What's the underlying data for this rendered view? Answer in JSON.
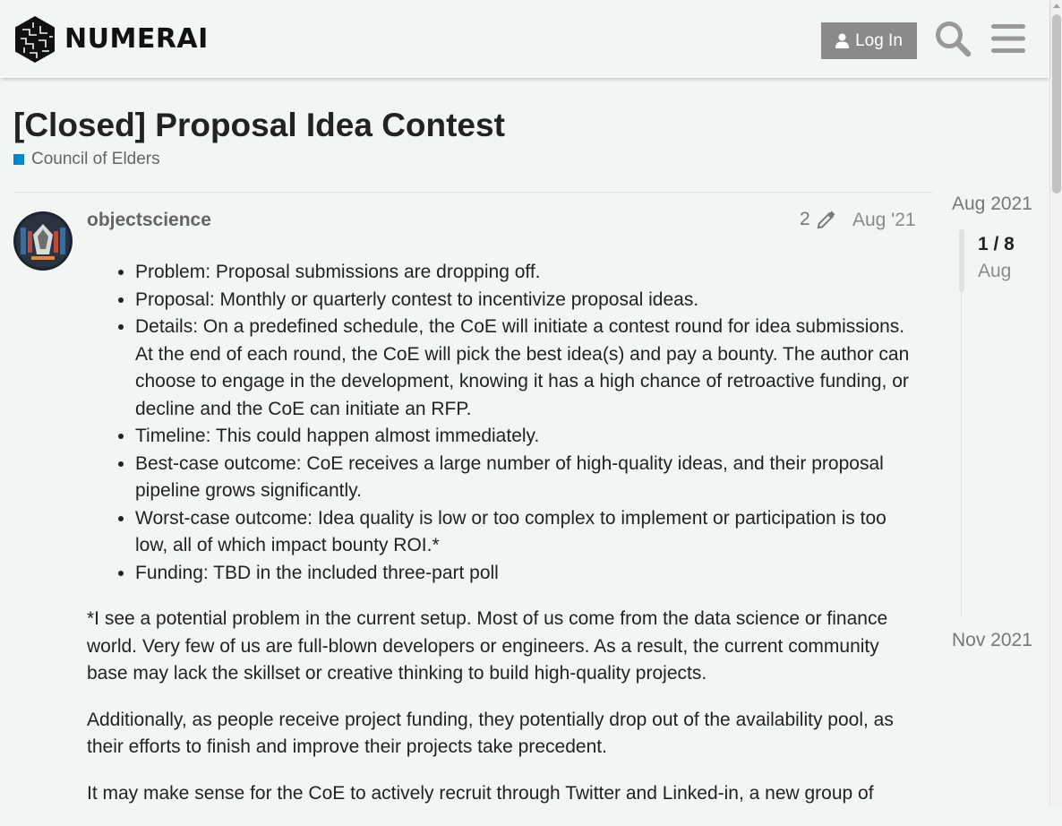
{
  "header": {
    "logo_text": "NUMERAI",
    "login_label": "Log In",
    "search_icon": "search-icon",
    "menu_icon": "hamburger-menu-icon"
  },
  "topic": {
    "title": "[Closed] Proposal Idea Contest",
    "category": "Council of Elders",
    "category_color": "#0088cc"
  },
  "post": {
    "username": "objectscience",
    "edit_count": "2",
    "date": "Aug '21",
    "bullets": [
      "Problem: Proposal submissions are dropping off.",
      "Proposal: Monthly or quarterly contest to incentivize proposal ideas.",
      "Details: On a predefined schedule, the CoE will initiate a contest round for idea submissions. At the end of each round, the CoE will pick the best idea(s) and pay a bounty. The author can choose to engage in the development, knowing it has a high chance of retroactive funding, or decline and the CoE can initiate an RFP.",
      "Timeline: This could happen almost immediately.",
      "Best-case outcome: CoE receives a large number of high-quality ideas, and their proposal pipeline grows significantly.",
      "Worst-case outcome: Idea quality is low or too complex to implement or participation is too low, all of which impact bounty ROI.*",
      "Funding: TBD in the included three-part poll"
    ],
    "paragraphs": [
      "*I see a potential problem in the current setup. Most of us come from the data science or finance world. Very few of us are full-blown developers or engineers. As a result, the current community base may lack the skillset or creative thinking to build high-quality projects.",
      "Additionally, as people receive project funding, they potentially drop out of the availability pool, as their efforts to finish and improve their projects take precedent.",
      "It may make sense for the CoE to actively recruit through Twitter and Linked-in, a new group of"
    ]
  },
  "timeline": {
    "start": "Aug 2021",
    "position": "1 / 8",
    "current": "Aug",
    "end": "Nov 2021"
  }
}
